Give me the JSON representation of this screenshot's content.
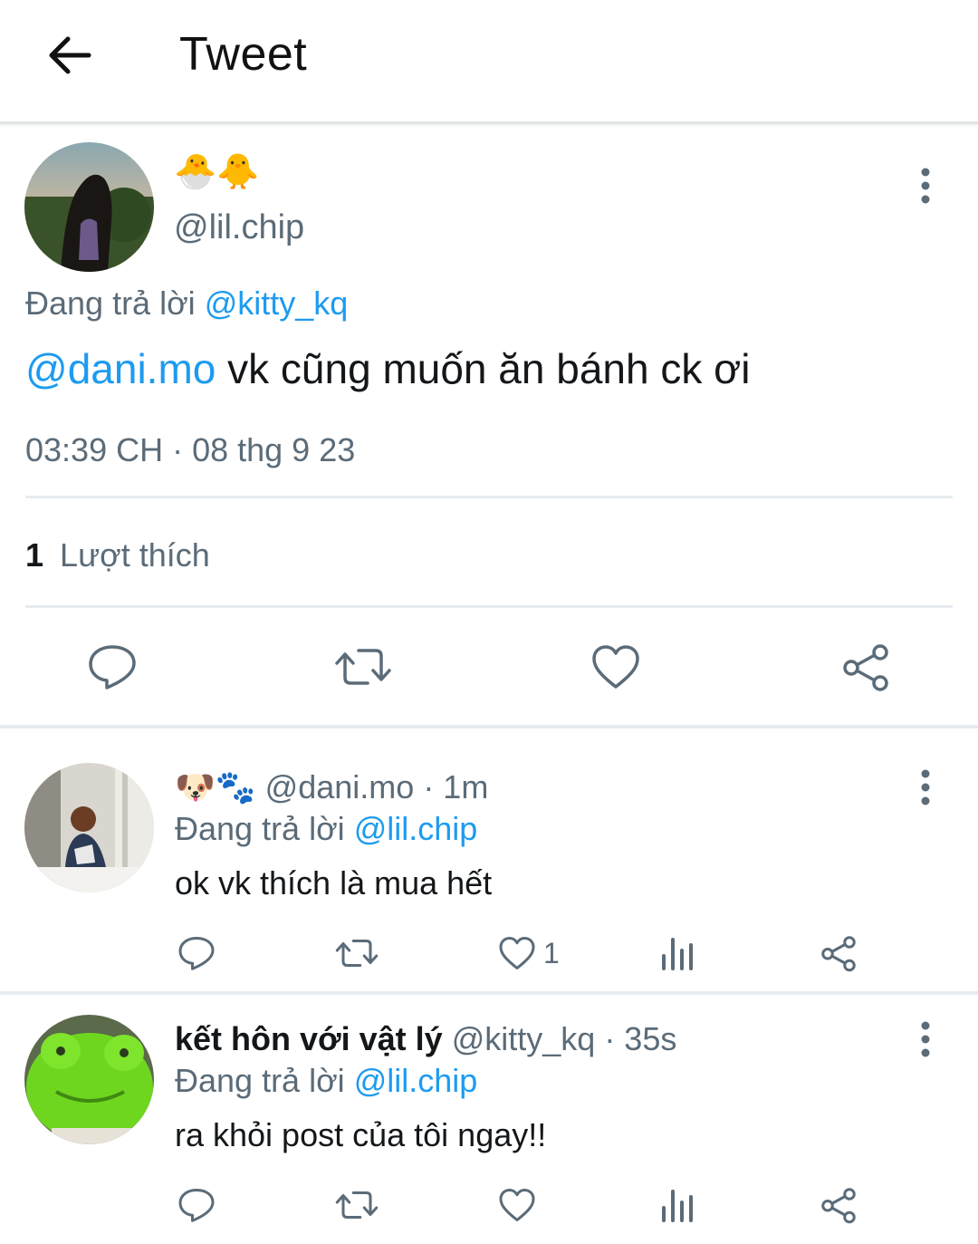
{
  "header": {
    "title": "Tweet"
  },
  "main_tweet": {
    "display_name": "🐣🐥",
    "handle": "@lil.chip",
    "replying_label": "Đang trả lời",
    "replying_to": "@kitty_kq",
    "mention": "@dani.mo",
    "text": "vk cũng muốn ăn bánh ck ơi",
    "timestamp": "03:39 CH · 08 thg 9 23",
    "likes_count": "1",
    "likes_label": "Lượt thích"
  },
  "replies": [
    {
      "display_name": "🐶🐾",
      "handle": "@dani.mo",
      "time": "· 1m",
      "replying_label": "Đang trả lời",
      "replying_to": "@lil.chip",
      "text": "ok vk thích là mua hết",
      "like_count": "1"
    },
    {
      "display_name": "kết hôn với vật lý",
      "handle": "@kitty_kq",
      "time": "· 35s",
      "replying_label": "Đang trả lời",
      "replying_to": "@lil.chip",
      "text": "ra khỏi post của tôi ngay!!",
      "like_count": ""
    }
  ],
  "colors": {
    "link": "#1d9bf0",
    "icon": "#5b6b78",
    "divider": "#e6ecf0"
  }
}
